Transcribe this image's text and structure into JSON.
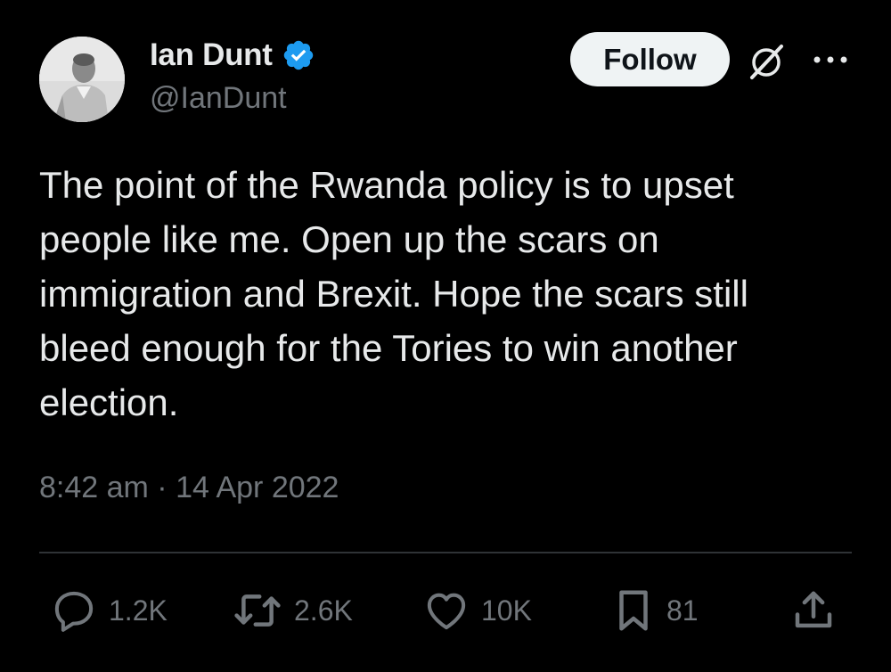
{
  "tweet": {
    "author": {
      "display_name": "Ian Dunt",
      "handle": "@IanDunt",
      "verified_color": "#1d9bf0"
    },
    "follow_label": "Follow",
    "text": "The point of the Rwanda policy is to upset\npeople like me. Open up the scars on\nimmigration and Brexit. Hope the scars still\nbleed enough for the Tories to win another\nelection.",
    "time": "8:42 am",
    "separator": " · ",
    "date": "14 Apr 2022",
    "stats": {
      "replies": "1.2K",
      "reposts": "2.6K",
      "likes": "10K",
      "bookmarks": "81"
    }
  },
  "icons": {
    "reply": "reply-icon",
    "repost": "repost-icon",
    "like": "heart-icon",
    "bookmark": "bookmark-icon",
    "share": "share-icon",
    "grok": "grok-icon",
    "more": "more-icon",
    "verified": "verified-badge-icon"
  },
  "colors": {
    "background": "#000000",
    "primary_text": "#e7e9ea",
    "secondary_text": "#71767b",
    "divider": "#2f3336",
    "follow_button_bg": "#eff3f4"
  }
}
